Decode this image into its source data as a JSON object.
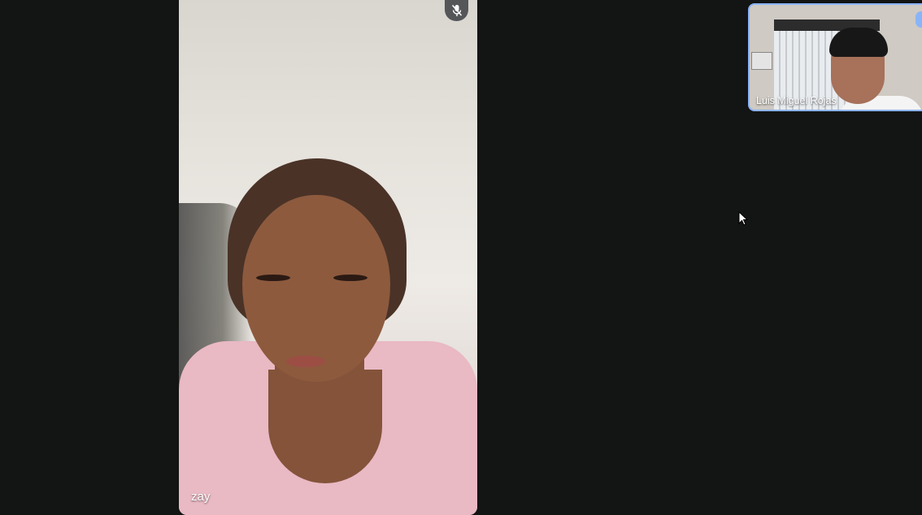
{
  "main_participant": {
    "name": "zay",
    "mic_state_icon": "mic-off-icon"
  },
  "self_view": {
    "name": "Luis Miguel Rojas",
    "highlight_color": "#8ab4f8"
  },
  "colors": {
    "background": "#131414"
  }
}
